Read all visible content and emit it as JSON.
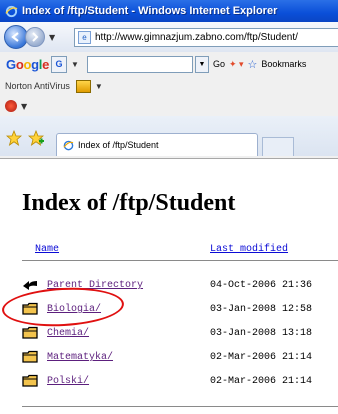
{
  "window": {
    "title": "Index of /ftp/Student - Windows Internet Explorer"
  },
  "address": {
    "url": "http://www.gimnazjum.zabno.com/ftp/Student/"
  },
  "google_bar": {
    "logo": "Google",
    "go": "Go",
    "bookmarks": "Bookmarks"
  },
  "norton": {
    "label": "Norton AntiVirus"
  },
  "tab": {
    "label": "Index of /ftp/Student"
  },
  "page": {
    "heading": "Index of /ftp/Student",
    "columns": {
      "name": "Name",
      "last_modified": "Last modified"
    },
    "rows": [
      {
        "name": "Parent Directory",
        "date": "04-Oct-2006 21:36",
        "icon": "back-arrow-icon"
      },
      {
        "name": "Biologia/",
        "date": "03-Jan-2008 12:58",
        "icon": "folder-icon",
        "highlighted": true
      },
      {
        "name": "Chemia/",
        "date": "03-Jan-2008 13:18",
        "icon": "folder-icon"
      },
      {
        "name": "Matematyka/",
        "date": "02-Mar-2006 21:14",
        "icon": "folder-icon"
      },
      {
        "name": "Polski/",
        "date": "02-Mar-2006 21:14",
        "icon": "folder-icon"
      }
    ]
  },
  "colors": {
    "title_bar": "#0a4fd8",
    "link_visited": "#5c1f7d",
    "link": "#0b0bd6",
    "highlight_ring": "#e01010"
  }
}
